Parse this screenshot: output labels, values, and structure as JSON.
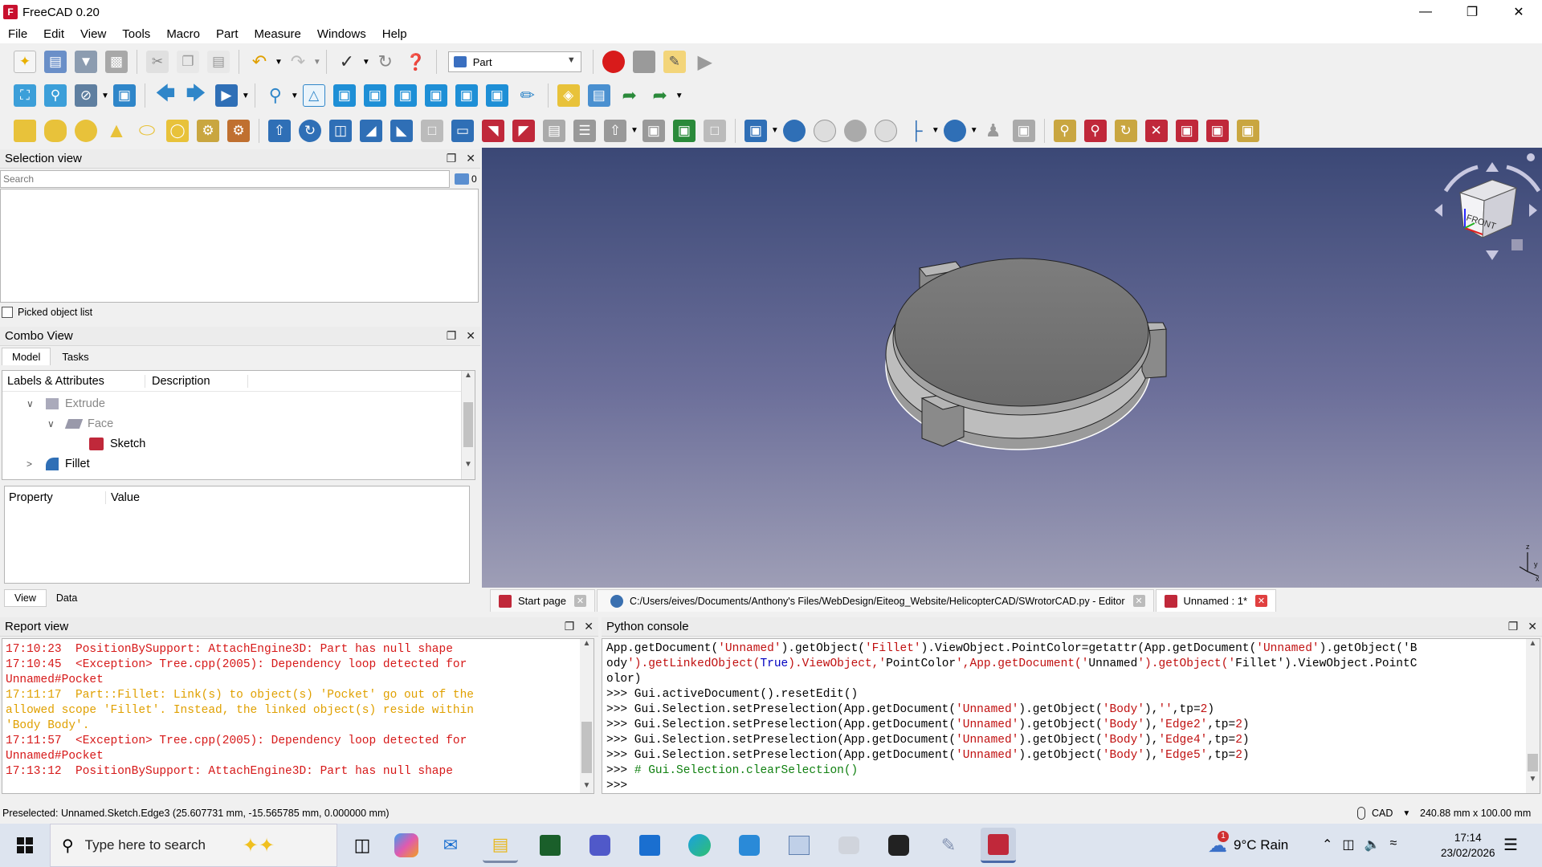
{
  "window": {
    "title": "FreeCAD 0.20",
    "icon_text": "F"
  },
  "menu": [
    "File",
    "Edit",
    "View",
    "Tools",
    "Macro",
    "Part",
    "Measure",
    "Windows",
    "Help"
  ],
  "workbench": {
    "selected": "Part"
  },
  "selection_view": {
    "title": "Selection view",
    "search_placeholder": "Search",
    "count": "0",
    "picked_label": "Picked object list"
  },
  "combo_view": {
    "title": "Combo View",
    "tabs": [
      "Model",
      "Tasks"
    ],
    "columns": [
      "Labels & Attributes",
      "Description"
    ],
    "tree": [
      {
        "label": "Extrude",
        "expander": "v",
        "level": 1,
        "dim": true
      },
      {
        "label": "Face",
        "expander": "v",
        "level": 2,
        "dim": true
      },
      {
        "label": "Sketch",
        "expander": "",
        "level": 3,
        "dim": false
      },
      {
        "label": "Fillet",
        "expander": ">",
        "level": 1,
        "dim": false
      }
    ],
    "prop_columns": [
      "Property",
      "Value"
    ],
    "bottom_tabs": [
      "View",
      "Data"
    ]
  },
  "doc_tabs": [
    {
      "label": "Start page",
      "active": false
    },
    {
      "label": "C:/Users/eives/Documents/Anthony's Files/WebDesign/Eiteog_Website/HelicopterCAD/SWrotorCAD.py - Editor",
      "active": false
    },
    {
      "label": "Unnamed : 1*",
      "active": true
    }
  ],
  "report_view": {
    "title": "Report view",
    "lines": [
      {
        "text": "17:10:23  PositionBySupport: AttachEngine3D: Part has null shape",
        "type": "error"
      },
      {
        "text": "17:10:45  <Exception> Tree.cpp(2005): Dependency loop detected for",
        "type": "error"
      },
      {
        "text": "Unnamed#Pocket",
        "type": "error"
      },
      {
        "text": "17:11:17  Part::Fillet: Link(s) to object(s) 'Pocket' go out of the",
        "type": "warning"
      },
      {
        "text": "allowed scope 'Fillet'. Instead, the linked object(s) reside within",
        "type": "warning"
      },
      {
        "text": "'Body Body'.",
        "type": "warning"
      },
      {
        "text": "17:11:57  <Exception> Tree.cpp(2005): Dependency loop detected for",
        "type": "error"
      },
      {
        "text": "Unnamed#Pocket",
        "type": "error"
      },
      {
        "text": "17:13:12  PositionBySupport: AttachEngine3D: Part has null shape",
        "type": "error"
      }
    ]
  },
  "python_console": {
    "title": "Python console",
    "lines": [
      "App.getDocument('Unnamed').getObject('Fillet').ViewObject.PointColor=getattr(App.getDocument('Unnamed').getObject('B",
      "ody').getLinkedObject(True).ViewObject,'PointColor',App.getDocument('Unnamed').getObject('Fillet').ViewObject.PointC",
      "olor)",
      ">>> Gui.activeDocument().resetEdit()",
      ">>> Gui.Selection.setPreselection(App.getDocument('Unnamed').getObject('Body'),'',tp=2)",
      ">>> Gui.Selection.setPreselection(App.getDocument('Unnamed').getObject('Body'),'Edge2',tp=2)",
      ">>> Gui.Selection.setPreselection(App.getDocument('Unnamed').getObject('Body'),'Edge4',tp=2)",
      ">>> Gui.Selection.setPreselection(App.getDocument('Unnamed').getObject('Body'),'Edge5',tp=2)",
      ">>> # Gui.Selection.clearSelection()",
      ">>> "
    ]
  },
  "status": {
    "message": "Preselected: Unnamed.Sketch.Edge3 (25.607731 mm, -15.565785 mm, 0.000000 mm)",
    "nav_style": "CAD",
    "dimensions": "240.88 mm x 100.00 mm"
  },
  "nav_cube": {
    "face_label": "FRONT"
  },
  "taskbar": {
    "search_placeholder": "Type here to search",
    "weather": "9°C  Rain",
    "weather_badge": "1",
    "time": "17:14",
    "date": "23/02/2026"
  },
  "colors": {
    "view_top": "#3b4876",
    "view_bottom": "#9e9eb6",
    "error_text": "#d61818",
    "warning_text": "#e0a000"
  }
}
